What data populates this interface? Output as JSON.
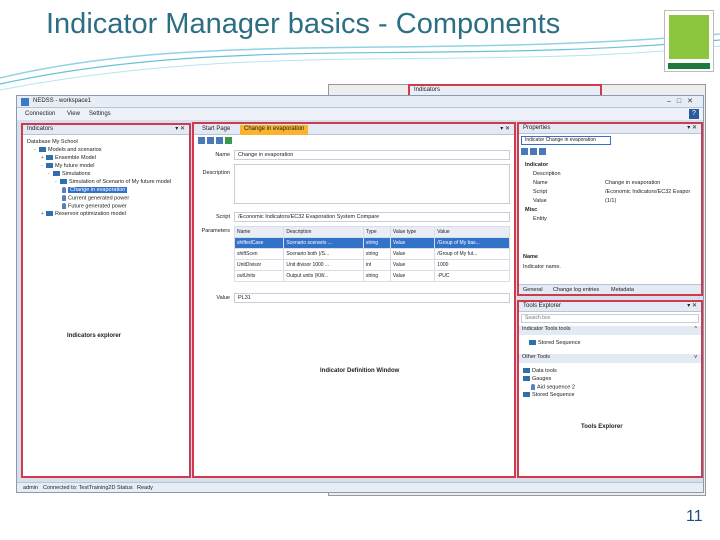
{
  "slide": {
    "title": "Indicator Manager basics - Components",
    "page_number": "11"
  },
  "floating_window": {
    "title": "Indicators"
  },
  "app": {
    "window_title": "NEDSS - workspace1",
    "menu": [
      "Connection",
      "View",
      "Settings"
    ]
  },
  "indicators_panel": {
    "title": "Indicators",
    "tree": [
      {
        "label": "Database My School",
        "indent": 0,
        "kind": "text"
      },
      {
        "label": "Models and scenarios",
        "indent": 1,
        "kind": "folder",
        "exp": "-"
      },
      {
        "label": "Ensemble Model",
        "indent": 2,
        "kind": "folder",
        "exp": "+"
      },
      {
        "label": "My future model",
        "indent": 2,
        "kind": "folder",
        "exp": "-"
      },
      {
        "label": "Simulations",
        "indent": 3,
        "kind": "folder",
        "exp": "-"
      },
      {
        "label": "Simulation of Scenario of My future model",
        "indent": 4,
        "kind": "folder",
        "exp": "-"
      },
      {
        "label": "Change in evaporation",
        "indent": 5,
        "kind": "pin",
        "selected": true
      },
      {
        "label": "Current generated power",
        "indent": 5,
        "kind": "pin"
      },
      {
        "label": "Future generated power",
        "indent": 5,
        "kind": "pin"
      },
      {
        "label": "Reservoir optimization model",
        "indent": 2,
        "kind": "folder",
        "exp": "+"
      }
    ],
    "caption": "Indicators explorer"
  },
  "definition": {
    "tabs": [
      "Start Page",
      "Change in evaporation"
    ],
    "labels": {
      "name": "Name",
      "description": "Description",
      "script": "Script",
      "parameters": "Parameters",
      "value": "Value"
    },
    "name_value": "Change in evaporation",
    "description_value": "",
    "script_value": "/Economic Indicators/EC32 Evaporation System Compare",
    "param_headers": [
      "Name",
      "Description",
      "Type",
      "Value type",
      "Value"
    ],
    "params": [
      [
        "shiftedCase",
        "Scenario scenario ...",
        "string",
        "Value",
        "/Group of My bas..."
      ],
      [
        "shiftScen",
        "Scenario both (/S...",
        "string",
        "Value",
        "/Group of My fut..."
      ],
      [
        "UnitDivisor",
        "Unit divisor 1000 ...",
        "int",
        "Value",
        "1000"
      ],
      [
        "outUnits",
        "Output units (KW...",
        "string",
        "Value",
        "-PUC"
      ]
    ],
    "value_value": "PL31",
    "caption": "Indicator Definition Window"
  },
  "properties": {
    "title": "Properties",
    "selector": "Indicator Change in evaporation",
    "rows": [
      {
        "kind": "group",
        "label": "Indicator"
      },
      {
        "kind": "prop",
        "label": "Description",
        "value": ""
      },
      {
        "kind": "prop",
        "label": "Name",
        "value": "Change in evaporation"
      },
      {
        "kind": "prop",
        "label": "Script",
        "value": "/Economic Indicators/EC32 Evapor"
      },
      {
        "kind": "prop",
        "label": "Value",
        "value": "(1/1)"
      },
      {
        "kind": "group",
        "label": "Misc"
      },
      {
        "kind": "prop",
        "label": "Entity",
        "value": ""
      }
    ],
    "help_title": "Name",
    "help_text": "Indicator name.",
    "tabs": [
      "General",
      "Change log entries",
      "Metadata"
    ]
  },
  "tools": {
    "title": "Tools Explorer",
    "search_placeholder": "Search box",
    "section1": "Indicator Tools tools",
    "section1_items": [
      "Stored Sequence"
    ],
    "section2": "Other Tools",
    "section2_items": [
      {
        "label": "Data tools",
        "indent": 0
      },
      {
        "label": "Gauges",
        "indent": 0
      },
      {
        "label": "Aid sequence 2",
        "indent": 1
      },
      {
        "label": "Stored Sequence",
        "indent": 0
      }
    ],
    "caption": "Tools Explorer"
  },
  "statusbar": {
    "user": "admin",
    "connection": "Connected to: TestTraining2D",
    "status_label": "Status",
    "status_value": "Ready"
  },
  "colors": {
    "highlight": "#d03a4c",
    "active_tab": "#f7b42c",
    "title": "#2c6e83"
  }
}
